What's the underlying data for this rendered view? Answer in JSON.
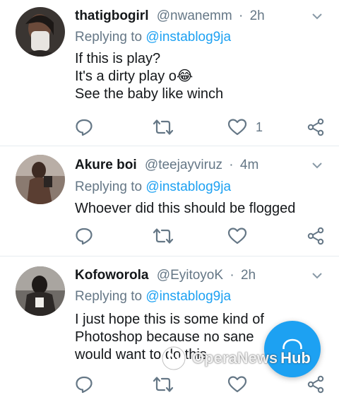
{
  "tweets": [
    {
      "name": "thatigbogirl",
      "handle": "@nwanemm",
      "time": "2h",
      "reply_prefix": "Replying to",
      "reply_to": "@instablog9ja",
      "lines": [
        "If this is play?",
        "It's a dirty play o😂",
        "See the baby like winch"
      ],
      "likes": "1"
    },
    {
      "name": "Akure boi",
      "handle": "@teejayviruz",
      "time": "4m",
      "reply_prefix": "Replying to",
      "reply_to": "@instablog9ja",
      "lines": [
        "Whoever did this should be flogged"
      ],
      "likes": ""
    },
    {
      "name": "Kofoworola",
      "handle": "@EyitoyoK",
      "time": "2h",
      "reply_prefix": "Replying to",
      "reply_to": "@instablog9ja",
      "lines": [
        "I just hope this is some kind of",
        "Photoshop because no sane",
        "would want to do this"
      ],
      "likes": ""
    }
  ],
  "watermark": {
    "text": "OperaNews",
    "hub": "Hub"
  },
  "colors": {
    "accent": "#1da1f2",
    "muted": "#657786",
    "text": "#14171a",
    "divider": "#e6ecf0"
  },
  "icons": [
    "reply-icon",
    "retweet-icon",
    "like-icon",
    "share-icon",
    "caret-down-icon",
    "compose-icon"
  ]
}
